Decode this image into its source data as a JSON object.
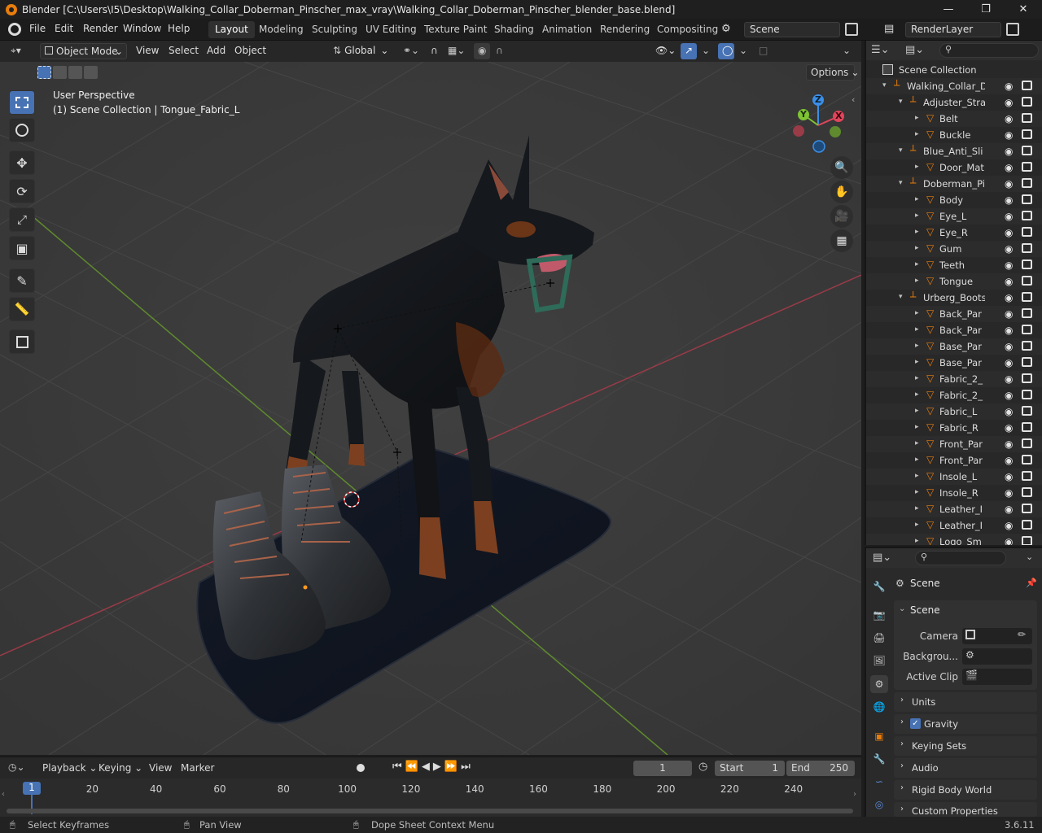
{
  "window": {
    "title": "Blender [C:\\Users\\I5\\Desktop\\Walking_Collar_Doberman_Pinscher_max_vray\\Walking_Collar_Doberman_Pinscher_blender_base.blend]",
    "minimize": "—",
    "maximize": "❐",
    "close": "✕"
  },
  "menu": {
    "items": [
      "File",
      "Edit",
      "Render",
      "Window",
      "Help"
    ],
    "workspaces": [
      "Layout",
      "Modeling",
      "Sculpting",
      "UV Editing",
      "Texture Paint",
      "Shading",
      "Animation",
      "Rendering",
      "Compositing"
    ],
    "active_workspace": "Layout",
    "scene": "Scene",
    "view_layer": "RenderLayer"
  },
  "viewport_header": {
    "mode": "Object Mode",
    "menus": [
      "View",
      "Select",
      "Add",
      "Object"
    ],
    "transform_orientation": "Global",
    "options_label": "Options"
  },
  "viewport": {
    "view_name": "User Perspective",
    "context": "(1) Scene Collection | Tongue_Fabric_L",
    "gizmo_axes": {
      "x": "X",
      "y": "Y",
      "z": "Z"
    }
  },
  "outliner": {
    "root": "Scene Collection",
    "rows": [
      {
        "label": "Walking_Collar_D",
        "type": "empty"
      },
      {
        "label": "Adjuster_Stra",
        "type": "empty"
      },
      {
        "label": "Belt",
        "type": "mesh"
      },
      {
        "label": "Buckle",
        "type": "mesh"
      },
      {
        "label": "Blue_Anti_Sli",
        "type": "empty"
      },
      {
        "label": "Door_Mat",
        "type": "mesh"
      },
      {
        "label": "Doberman_Pi",
        "type": "empty"
      },
      {
        "label": "Body",
        "type": "mesh"
      },
      {
        "label": "Eye_L",
        "type": "mesh"
      },
      {
        "label": "Eye_R",
        "type": "mesh"
      },
      {
        "label": "Gum",
        "type": "mesh"
      },
      {
        "label": "Teeth",
        "type": "mesh"
      },
      {
        "label": "Tongue",
        "type": "mesh"
      },
      {
        "label": "Urberg_Boots",
        "type": "empty"
      },
      {
        "label": "Back_Par",
        "type": "mesh"
      },
      {
        "label": "Back_Par",
        "type": "mesh"
      },
      {
        "label": "Base_Par",
        "type": "mesh"
      },
      {
        "label": "Base_Par",
        "type": "mesh"
      },
      {
        "label": "Fabric_2_",
        "type": "mesh"
      },
      {
        "label": "Fabric_2_",
        "type": "mesh"
      },
      {
        "label": "Fabric_L",
        "type": "mesh"
      },
      {
        "label": "Fabric_R",
        "type": "mesh"
      },
      {
        "label": "Front_Par",
        "type": "mesh"
      },
      {
        "label": "Front_Par",
        "type": "mesh"
      },
      {
        "label": "Insole_L",
        "type": "mesh"
      },
      {
        "label": "Insole_R",
        "type": "mesh"
      },
      {
        "label": "Leather_I",
        "type": "mesh"
      },
      {
        "label": "Leather_I",
        "type": "mesh"
      },
      {
        "label": "Logo_Sm",
        "type": "mesh"
      }
    ]
  },
  "properties": {
    "context_name": "Scene",
    "panel_title": "Scene",
    "fields": [
      {
        "label": "Camera"
      },
      {
        "label": "Backgrou..."
      },
      {
        "label": "Active Clip"
      }
    ],
    "subpanels": [
      "Units",
      "Gravity",
      "Keying Sets",
      "Audio",
      "Rigid Body World",
      "Custom Properties"
    ],
    "gravity_checked": true
  },
  "timeline": {
    "menus": [
      "Playback",
      "Keying",
      "View",
      "Marker"
    ],
    "current_frame": "1",
    "start_label": "Start",
    "start": "1",
    "end_label": "End",
    "end": "250",
    "ruler": [
      "20",
      "40",
      "60",
      "80",
      "100",
      "120",
      "140",
      "160",
      "180",
      "200",
      "220",
      "240"
    ],
    "playhead_label": "1"
  },
  "statusbar": {
    "left": "Select Keyframes",
    "middle": "Pan View",
    "right": "Dope Sheet Context Menu",
    "version": "3.6.11"
  },
  "colors": {
    "accent": "#4772b3",
    "orange": "#e87d0d",
    "axis_x": "#e0455b",
    "axis_y": "#7fc433",
    "axis_z": "#3a8fe8"
  }
}
